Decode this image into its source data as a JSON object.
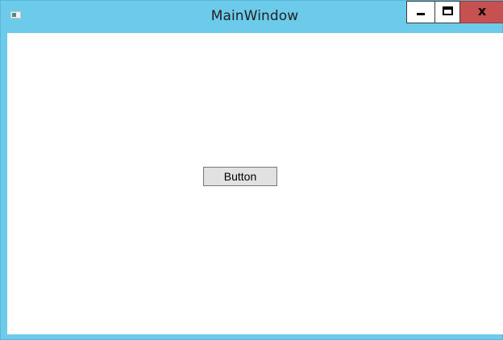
{
  "window": {
    "title": "MainWindow",
    "caption": {
      "minimize_icon": "minimize-icon",
      "maximize_icon": "maximize-icon",
      "close_glyph": "x",
      "close_color": "#c75050",
      "frame_color": "#6ccbea"
    }
  },
  "content": {
    "button_label": "Button"
  }
}
